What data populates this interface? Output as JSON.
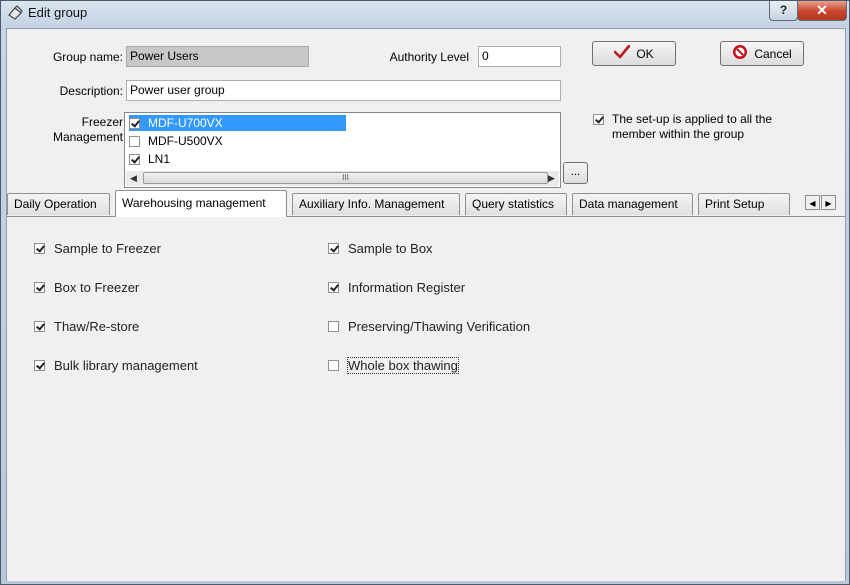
{
  "window": {
    "title": "Edit group",
    "help_glyph": "?",
    "close_glyph": "✕"
  },
  "form": {
    "group_name_label": "Group name:",
    "group_name_value": "Power Users",
    "authority_label": "Authority Level",
    "authority_value": "0",
    "description_label": "Description:",
    "description_value": "Power user group",
    "freezer_label_1": "Freezer",
    "freezer_label_2": "Management",
    "ok_label": "OK",
    "cancel_label": "Cancel",
    "apply_all_label": "The set-up is applied to all the member within the group",
    "apply_all_checked": true,
    "ellipsis_label": "...",
    "scroll_grip": "III"
  },
  "freezers": [
    {
      "label": "MDF-U700VX",
      "checked": true,
      "selected": true
    },
    {
      "label": "MDF-U500VX",
      "checked": false,
      "selected": false
    },
    {
      "label": "LN1",
      "checked": true,
      "selected": false
    }
  ],
  "tabs": [
    {
      "label": "Daily Operation",
      "active": false
    },
    {
      "label": "Warehousing management",
      "active": true
    },
    {
      "label": "Auxiliary Info. Management",
      "active": false
    },
    {
      "label": "Query statistics",
      "active": false
    },
    {
      "label": "Data management",
      "active": false
    },
    {
      "label": "Print Setup",
      "active": false
    }
  ],
  "permissions_left": [
    {
      "label": "Sample to Freezer",
      "checked": true
    },
    {
      "label": "Box to Freezer",
      "checked": true
    },
    {
      "label": "Thaw/Re-store",
      "checked": true
    },
    {
      "label": "Bulk library management",
      "checked": true
    }
  ],
  "permissions_right": [
    {
      "label": "Sample to Box",
      "checked": true
    },
    {
      "label": "Information Register",
      "checked": true
    },
    {
      "label": "Preserving/Thawing Verification",
      "checked": false
    },
    {
      "label": "Whole box thawing",
      "checked": false
    }
  ],
  "colors": {
    "selection": "#3399ff",
    "ok_check": "#c0171c",
    "cancel_icon": "#c0171c"
  }
}
